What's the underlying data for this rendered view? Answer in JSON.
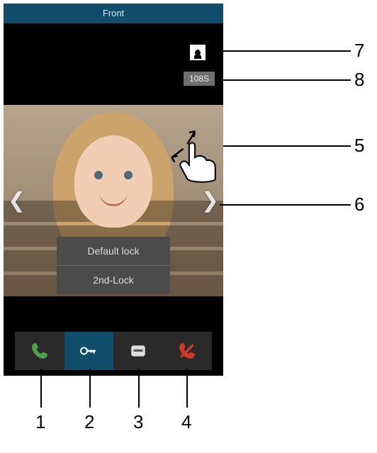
{
  "header": {
    "title": "Front"
  },
  "status": {
    "timer": "108S"
  },
  "lock_menu": {
    "items": [
      {
        "label": "Default lock"
      },
      {
        "label": "2nd-Lock"
      }
    ]
  },
  "buttons": {
    "call": {
      "name": "call-button",
      "color": "#4fa24a"
    },
    "unlock": {
      "name": "unlock-button",
      "color": "#ffffff"
    },
    "light": {
      "name": "actuator-button",
      "color": "#dddddd"
    },
    "hangup": {
      "name": "hangup-button",
      "color": "#d23b2a"
    }
  },
  "icons": {
    "info": "info-icon",
    "pinch": "pinch-gesture-icon",
    "prev": "prev-arrow-icon",
    "next": "next-arrow-icon"
  },
  "callouts": {
    "n1": "1",
    "n2": "2",
    "n3": "3",
    "n4": "4",
    "n5": "5",
    "n6": "6",
    "n7": "7",
    "n8": "8"
  }
}
